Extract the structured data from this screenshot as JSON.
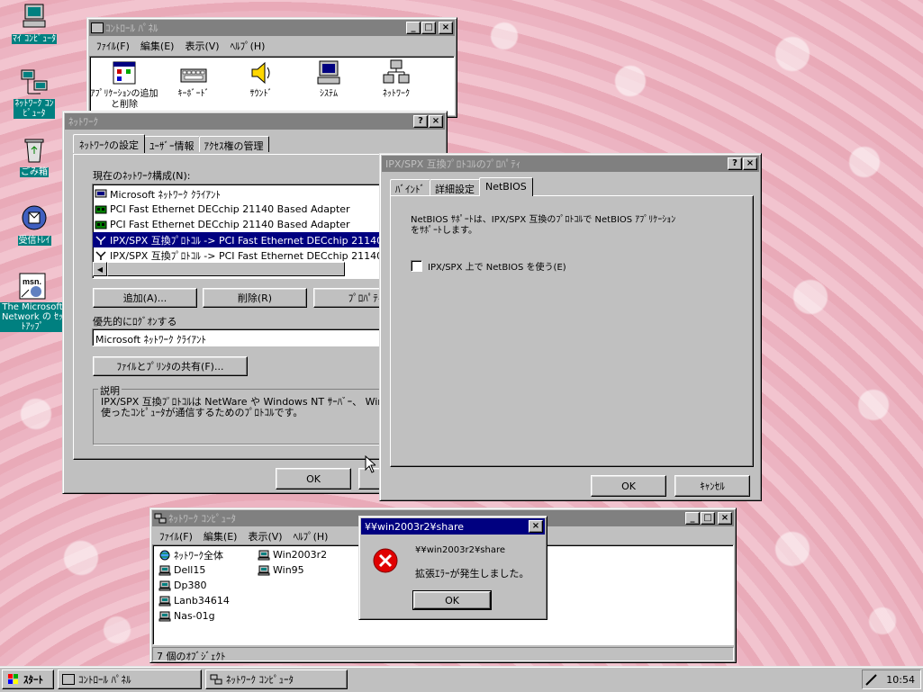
{
  "desktop": {
    "icons": [
      {
        "label": "ﾏｲ ｺﾝﾋﾟｭｰﾀ"
      },
      {
        "label": "ﾈｯﾄﾜｰｸ ｺﾝﾋﾟｭｰﾀ"
      },
      {
        "label": "ごみ箱"
      },
      {
        "label": "受信ﾄﾚｲ"
      },
      {
        "label": "The Microsoft Network の ｾｯﾄｱｯﾌﾟ"
      }
    ]
  },
  "control_panel": {
    "title": "ｺﾝﾄﾛｰﾙ ﾊﾟﾈﾙ",
    "menu": [
      "ﾌｧｲﾙ(F)",
      "編集(E)",
      "表示(V)",
      "ﾍﾙﾌﾟ(H)"
    ],
    "items": [
      {
        "label": "ｱﾌﾟﾘｹｰｼｮﾝの追加と削除"
      },
      {
        "label": "ｷｰﾎﾞｰﾄﾞ"
      },
      {
        "label": "ｻｳﾝﾄﾞ"
      },
      {
        "label": "ｼｽﾃﾑ"
      },
      {
        "label": "ﾈｯﾄﾜｰｸ"
      }
    ]
  },
  "network": {
    "title": "ﾈｯﾄﾜｰｸ",
    "tabs": [
      "ﾈｯﾄﾜｰｸの設定",
      "ﾕｰｻﾞｰ情報",
      "ｱｸｾｽ権の管理"
    ],
    "config_label": "現在のﾈｯﾄﾜｰｸ構成(N):",
    "components": [
      {
        "label": "Microsoft ﾈｯﾄﾜｰｸ ｸﾗｲｱﾝﾄ",
        "icon": "client-icon"
      },
      {
        "label": "PCI Fast Ethernet DECchip 21140 Based Adapter",
        "icon": "adapter-icon"
      },
      {
        "label": "PCI Fast Ethernet DECchip 21140 Based Adapter",
        "icon": "adapter-icon"
      },
      {
        "label": "IPX/SPX 互換ﾌﾟﾛﾄｺﾙ -> PCI Fast Ethernet DECchip 21140",
        "icon": "protocol-icon"
      },
      {
        "label": "IPX/SPX 互換ﾌﾟﾛﾄｺﾙ -> PCI Fast Ethernet DECchip 21140",
        "icon": "protocol-icon"
      }
    ],
    "add_button": "追加(A)...",
    "remove_button": "削除(R)",
    "properties_button": "ﾌﾟﾛﾊﾟﾃｨ",
    "logon_label": "優先的にﾛｸﾞｵﾝする",
    "logon_value": "Microsoft ﾈｯﾄﾜｰｸ ｸﾗｲｱﾝﾄ",
    "file_print_button": "ﾌｧｲﾙとﾌﾟﾘﾝﾀの共有(F)...",
    "desc_label": "説明",
    "desc_text": "IPX/SPX 互換ﾌﾟﾛﾄｺﾙは NetWare や Windows NT ｻｰﾊﾞｰ、 Windows 95 を使ったｺﾝﾋﾟｭｰﾀが通信するためのﾌﾟﾛﾄｺﾙです。",
    "ok": "OK"
  },
  "ipx_props": {
    "title": "IPX/SPX 互換ﾌﾟﾛﾄｺﾙのﾌﾟﾛﾊﾟﾃｨ",
    "tabs": [
      "ﾊﾞｲﾝﾄﾞ",
      "詳細設定",
      "NetBIOS"
    ],
    "desc": "NetBIOS ｻﾎﾟｰﾄは、IPX/SPX 互換のﾌﾟﾛﾄｺﾙで NetBIOS ｱﾌﾟﾘｹｰｼｮﾝをｻﾎﾟｰﾄします。",
    "checkbox_label": "IPX/SPX 上で NetBIOS を使う(E)",
    "ok": "OK",
    "cancel": "ｷｬﾝｾﾙ"
  },
  "network_computer": {
    "title": "ﾈｯﾄﾜｰｸ ｺﾝﾋﾟｭｰﾀ",
    "menu": [
      "ﾌｧｲﾙ(F)",
      "編集(E)",
      "表示(V)",
      "ﾍﾙﾌﾟ(H)"
    ],
    "items_col1": [
      "ﾈｯﾄﾜｰｸ全体",
      "Dell15",
      "Dp380",
      "Lanb34614",
      "Nas-01g"
    ],
    "items_col2": [
      "Win2003r2",
      "Win95"
    ],
    "status": "7 個のｵﾌﾞｼﾞｪｸﾄ"
  },
  "error_dialog": {
    "title": "¥¥win2003r2¥share",
    "path": "¥¥win2003r2¥share",
    "message": "拡張ｴﾗｰが発生しました。",
    "ok": "OK"
  },
  "taskbar": {
    "start": "ｽﾀｰﾄ",
    "tasks": [
      "ｺﾝﾄﾛｰﾙ ﾊﾟﾈﾙ",
      "ﾈｯﾄﾜｰｸ ｺﾝﾋﾟｭｰﾀ"
    ],
    "clock": "10:54"
  }
}
